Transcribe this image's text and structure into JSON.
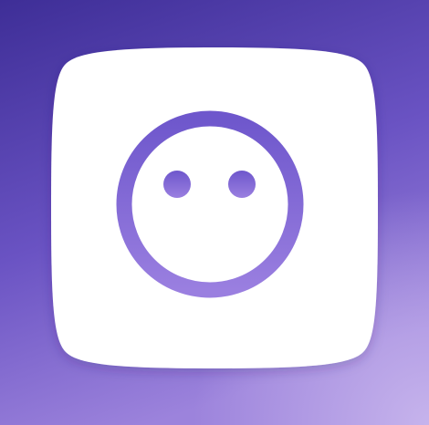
{
  "colors": {
    "background_top": "#3e2e97",
    "background_mid": "#6a53c3",
    "background_bottom": "#9c83dc",
    "background_glow": "#cbb9ee",
    "tile": "#ffffff",
    "glyph_top": "#6e57cc",
    "glyph_bottom": "#9a7fe0"
  },
  "app_icon": {
    "icon_name": "smiley-face-icon"
  }
}
